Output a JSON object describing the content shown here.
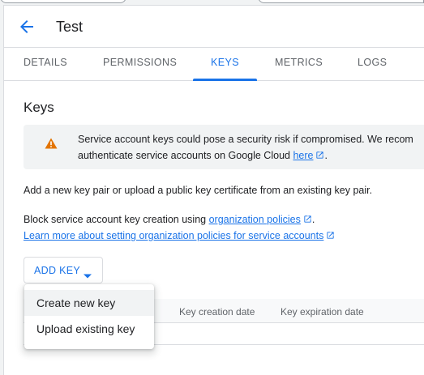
{
  "header": {
    "title": "Test"
  },
  "tabs": [
    {
      "label": "DETAILS",
      "active": false
    },
    {
      "label": "PERMISSIONS",
      "active": false
    },
    {
      "label": "KEYS",
      "active": true
    },
    {
      "label": "METRICS",
      "active": false
    },
    {
      "label": "LOGS",
      "active": false
    }
  ],
  "keys": {
    "title": "Keys",
    "warning": {
      "line1": "Service account keys could pose a security risk if compromised. We recom",
      "line2_prefix": "authenticate service accounts on Google Cloud ",
      "link": "here",
      "line2_suffix": "."
    },
    "intro": "Add a new key pair or upload a public key certificate from an existing key pair.",
    "block_prefix": "Block service account key creation using ",
    "block_link": "organization policies",
    "block_suffix": ".",
    "learn_more": "Learn more about setting organization policies for service accounts",
    "add_key_label": "ADD KEY",
    "table_headers": [
      "Key creation date",
      "Key expiration date"
    ]
  },
  "menu": {
    "items": [
      "Create new key",
      "Upload existing key"
    ]
  },
  "colors": {
    "accent": "#1a73e8",
    "warning": "#e37400"
  }
}
